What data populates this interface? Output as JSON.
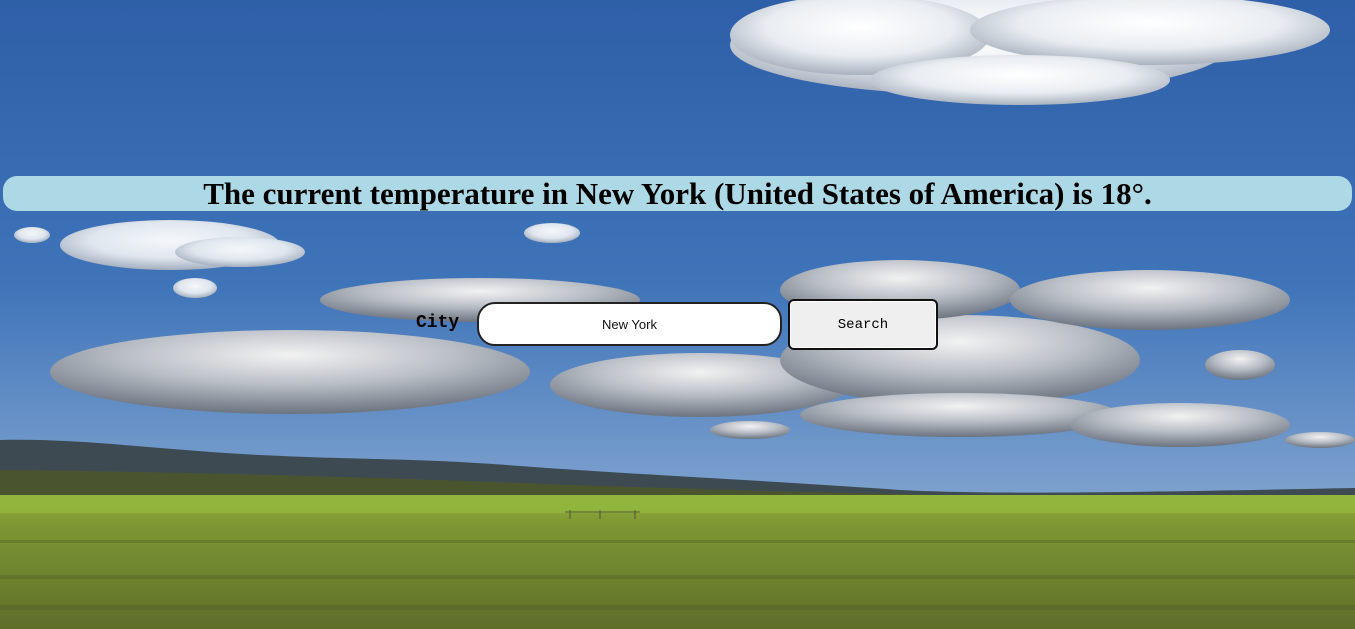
{
  "weather": {
    "message": "The current temperature in New York (United States of America) is 18°."
  },
  "search": {
    "city_label": "City",
    "city_value": "New York",
    "button_label": "Search"
  },
  "background": {
    "sky_top": "#2f64b0",
    "sky_bottom": "#8fb1d6",
    "grass": "#6f8a2c",
    "banner": "#add8e6"
  }
}
